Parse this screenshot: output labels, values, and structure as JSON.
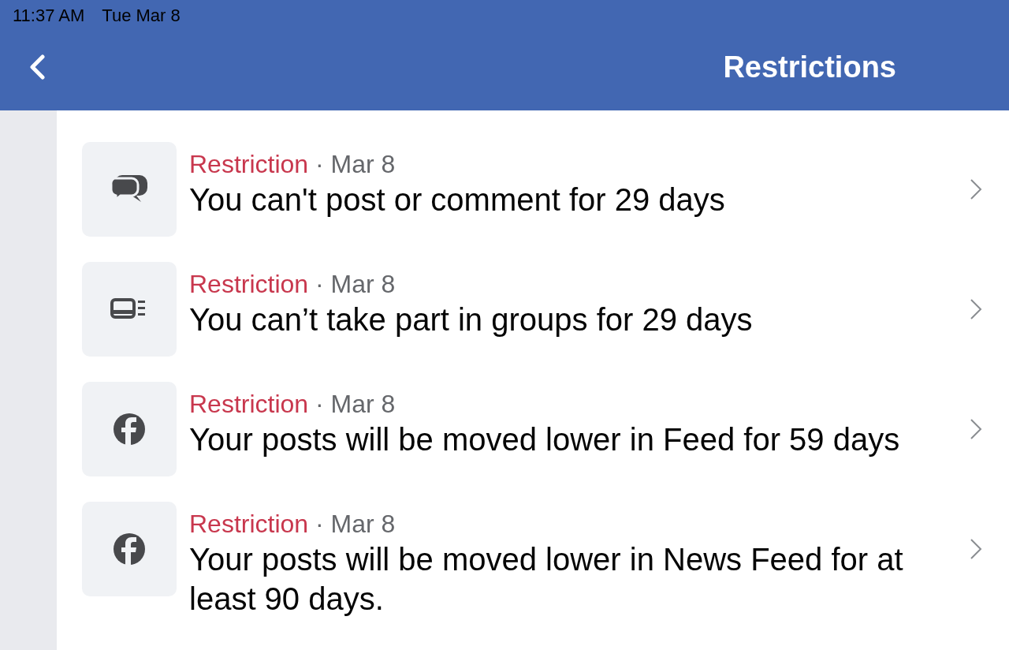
{
  "status_bar": {
    "time": "11:37 AM",
    "date": "Tue Mar 8"
  },
  "header": {
    "title": "Restrictions"
  },
  "restrictions": [
    {
      "kind": "chat",
      "label": "Restriction",
      "date": "· Mar 8",
      "text": "You can't post or comment for 29 days"
    },
    {
      "kind": "groups",
      "label": "Restriction",
      "date": "· Mar 8",
      "text": "You can’t take part in groups for 29 days"
    },
    {
      "kind": "facebook",
      "label": "Restriction",
      "date": "· Mar 8",
      "text": "Your posts will be moved lower in Feed for 59 days"
    },
    {
      "kind": "facebook",
      "label": "Restriction",
      "date": "· Mar 8",
      "text": "Your posts will be moved lower in News Feed for at least 90 days."
    }
  ]
}
